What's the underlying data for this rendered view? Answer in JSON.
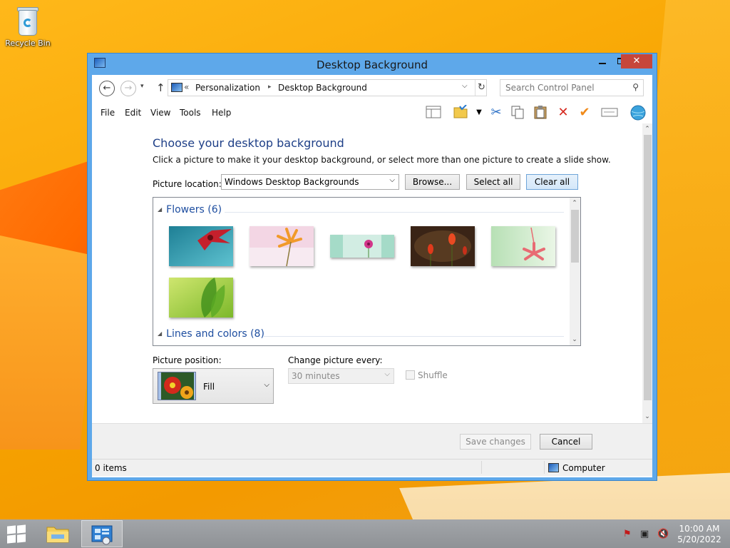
{
  "desktop": {
    "icons": [
      {
        "label": "Recycle Bin",
        "icon": "recycle-bin-icon"
      }
    ]
  },
  "window": {
    "title": "Desktop Background",
    "controls": {
      "minimize": "—",
      "maximize": "□",
      "close": "✕"
    }
  },
  "nav": {
    "back_symbol": "←",
    "forward_symbol": "→",
    "dropdown_symbol": "▾",
    "up_symbol": "↑",
    "breadcrumb": [
      "Personalization",
      "Desktop Background"
    ],
    "breadcrumb_prefix": "«",
    "breadcrumb_sep": "▸",
    "search_placeholder": "Search Control Panel"
  },
  "menu": [
    "File",
    "Edit",
    "View",
    "Tools",
    "Help"
  ],
  "toolbar_icons": [
    "layout-icon",
    "properties-icon",
    "cut-icon",
    "copy-icon",
    "paste-icon",
    "delete-icon",
    "check-icon",
    "rename-icon",
    "globe-icon"
  ],
  "page": {
    "heading": "Choose your desktop background",
    "subtext": "Click a picture to make it your desktop background, or select more than one picture to create a slide show.",
    "location_label": "Picture location:",
    "location_value": "Windows Desktop Backgrounds",
    "browse_label": "Browse...",
    "select_all_label": "Select all",
    "clear_all_label": "Clear all"
  },
  "gallery": {
    "groups": [
      {
        "name": "Flowers (6)",
        "count": 6
      },
      {
        "name": "Lines and colors (8)",
        "count": 8
      }
    ],
    "thumbnails": [
      {
        "name": "red-flower-teal",
        "colors": [
          "#1e7f95",
          "#5ec2d0",
          "#c5202c"
        ]
      },
      {
        "name": "orange-flower-pink",
        "colors": [
          "#f3d6e4",
          "#f7eaf1",
          "#f19a2a"
        ]
      },
      {
        "name": "pink-flower-mint",
        "colors": [
          "#a5dbc8",
          "#e6f5ee",
          "#d2368a"
        ]
      },
      {
        "name": "red-tulips-dark",
        "colors": [
          "#3a2416",
          "#6a4a2a",
          "#e03a1c"
        ]
      },
      {
        "name": "pink-flower-green",
        "colors": [
          "#b7e0b5",
          "#eaf6e6",
          "#e86b73"
        ]
      },
      {
        "name": "green-leaf",
        "colors": [
          "#cfe66f",
          "#7cb82a",
          "#3f8f1a"
        ]
      }
    ]
  },
  "position": {
    "label": "Picture position:",
    "value": "Fill"
  },
  "change": {
    "label": "Change picture every:",
    "value": "30 minutes"
  },
  "shuffle_label": "Shuffle",
  "actions": {
    "save_label": "Save changes",
    "cancel_label": "Cancel"
  },
  "status": {
    "items": "0 items",
    "location": "Computer"
  },
  "taskbar": {
    "time": "10:00 AM",
    "date": "5/20/2022"
  },
  "colors": {
    "accent": "#5ea8ea",
    "heading": "#1e3f87",
    "close_button": "#c7463b"
  }
}
